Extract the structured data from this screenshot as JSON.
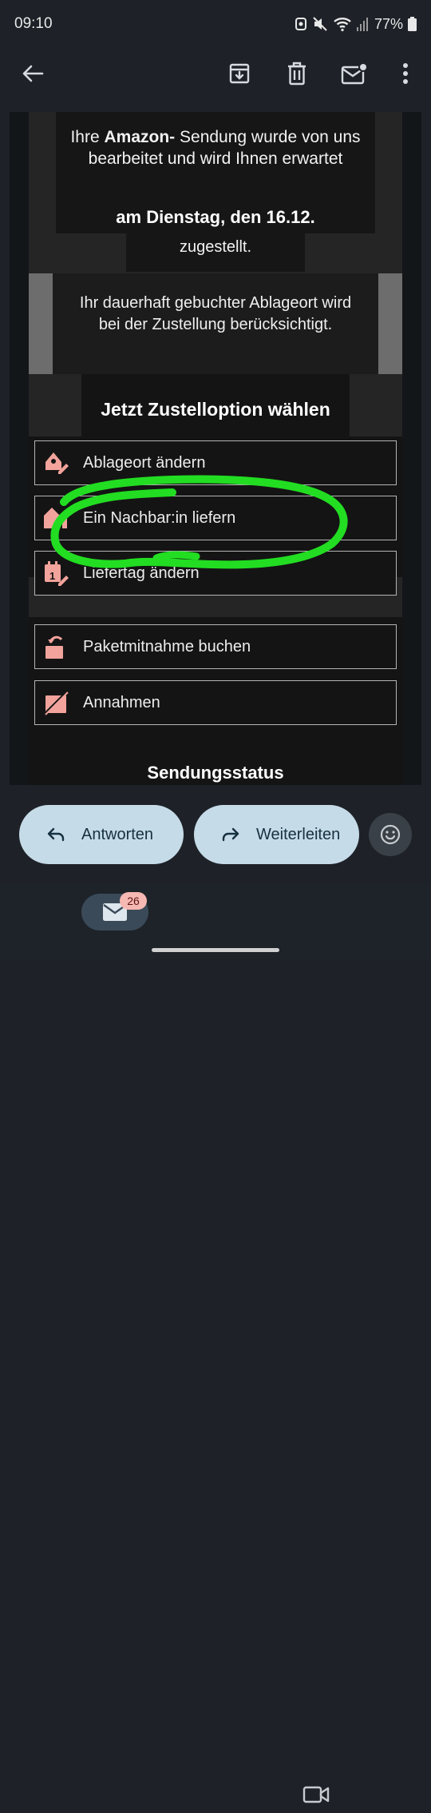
{
  "status_bar": {
    "time": "09:10",
    "battery": "77%"
  },
  "toolbar": {
    "back_icon": "arrow-left",
    "archive_icon": "archive",
    "delete_icon": "trash",
    "unread_icon": "mail-unread",
    "more_icon": "more-vertical"
  },
  "email": {
    "intro_prefix": "Ihre ",
    "intro_brand": "Amazon-",
    "intro_rest": " Sendung wurde von uns bearbeitet und wird Ihnen erwartet",
    "date_line": "am Dienstag, den 16.12.",
    "delivered_text": "zugestellt.",
    "storage_text": "Ihr dauerhaft gebuchter Ablageort wird bei der Zustellung berücksichtigt.",
    "options_heading": "Jetzt Zustelloption wählen",
    "options": [
      {
        "label": "Ablageort ändern",
        "icon": "place-edit"
      },
      {
        "label": "Ein Nachbar:in liefern",
        "icon": "neighbour-house"
      },
      {
        "label": "Liefertag ändern",
        "icon": "calendar-edit"
      },
      {
        "label": "Paketmitnahme buchen",
        "icon": "package-return"
      },
      {
        "label": "Annahmen",
        "icon": "package-refuse"
      }
    ],
    "status_heading": "Sendungsstatus",
    "accent_color": "#f2a39b",
    "highlight_color": "#22dd22"
  },
  "actions": {
    "reply_label": "Antworten",
    "forward_label": "Weiterleiten",
    "emoji_icon": "emoji-reaction"
  },
  "nav": {
    "mail_badge": "26",
    "mail_icon": "mail",
    "meet_icon": "video"
  }
}
